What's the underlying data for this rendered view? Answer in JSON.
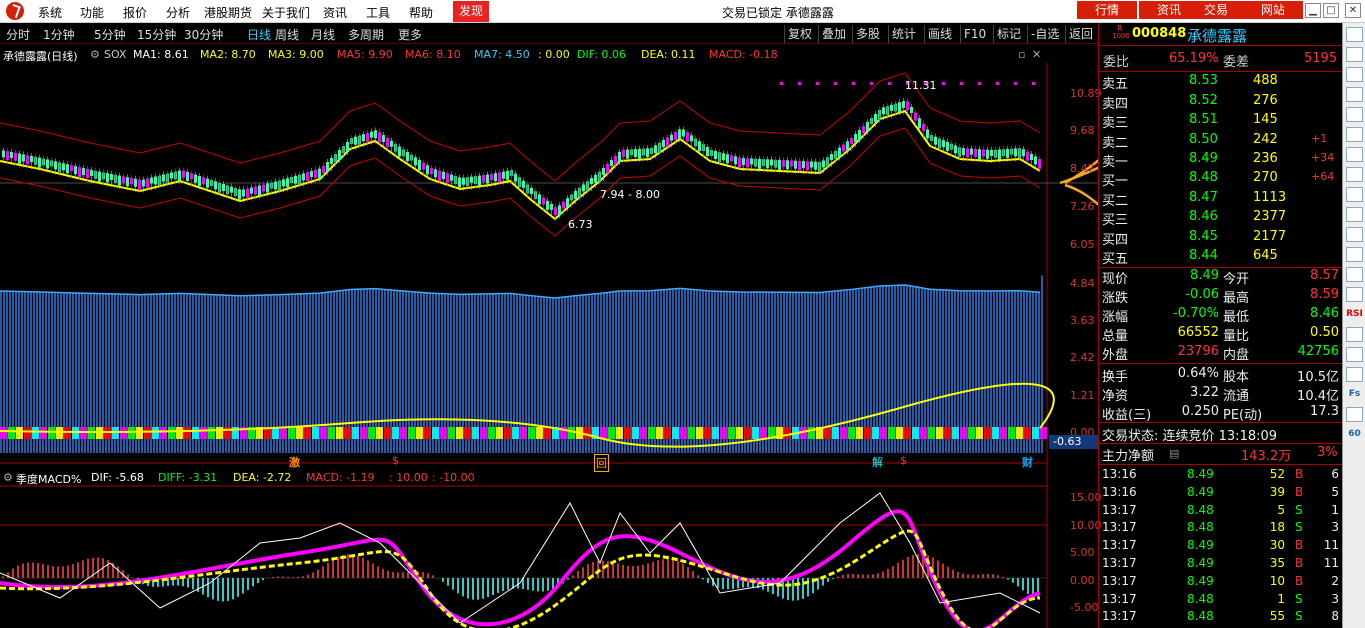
{
  "menu": {
    "items": [
      "系统",
      "功能",
      "报价",
      "分析",
      "港股期货",
      "关于我们",
      "资讯",
      "工具",
      "帮助"
    ],
    "active": "发现",
    "title": "交易已锁定  承德露露",
    "right": [
      "行情",
      "资讯",
      "交易",
      "网站"
    ]
  },
  "period_tabs": {
    "items": [
      "分时",
      "1分钟",
      "5分钟",
      "15分钟",
      "30分钟",
      "日线",
      "周线",
      "月线",
      "多周期",
      "更多"
    ],
    "active": "日线"
  },
  "right_tools": [
    "复权",
    "叠加",
    "多股",
    "统计",
    "画线",
    "F10",
    "标记",
    "-自选",
    "返回"
  ],
  "main_ind": {
    "name": "承德露露(日线)",
    "sox": "SOX",
    "ma1": "MA1: 8.61",
    "ma2": "MA2: 8.70",
    "ma3": "MA3: 9.00",
    "ma5": "MA5: 9.90",
    "ma6": "MA6: 8.10",
    "ma7": "MA7: 4.50",
    "v0": ": 0.00",
    "dif": "DIF: 0.06",
    "dea": "DEA: 0.11",
    "macd": "MACD: -0.18"
  },
  "annotations": {
    "high": "11.31",
    "low": "6.73",
    "range": "7.94 - 8.00",
    "neg": "-0.63"
  },
  "markers": [
    "激",
    "$",
    "回",
    "解",
    "$",
    "财"
  ],
  "axis_main": [
    "10.89",
    "9.68",
    "8.47",
    "7.26",
    "6.05",
    "4.84",
    "3.63",
    "2.42",
    "1.21",
    "0.00"
  ],
  "axis_sub": [
    "15.00",
    "10.00",
    "5.00",
    "0.00",
    "-5.00"
  ],
  "sub_ind": {
    "name": "季度MACD%",
    "dif": "DIF: -5.68",
    "diff": "DIFF: -3.31",
    "dea": "DEA: -2.72",
    "macd": "MACD: -1.19",
    "a": ": 10.00",
    "b": ": -10.00"
  },
  "quote": {
    "code": "000848",
    "name": "承德露露",
    "r_label": "R",
    "r_sub": "1000",
    "wb_label": "委比",
    "wb": "65.19%",
    "wc_label": "委差",
    "wc": "5195",
    "asks": [
      {
        "l": "卖五",
        "p": "8.53",
        "v": "488",
        "d": ""
      },
      {
        "l": "卖四",
        "p": "8.52",
        "v": "276",
        "d": ""
      },
      {
        "l": "卖三",
        "p": "8.51",
        "v": "145",
        "d": ""
      },
      {
        "l": "卖二",
        "p": "8.50",
        "v": "242",
        "d": "+1"
      },
      {
        "l": "卖一",
        "p": "8.49",
        "v": "236",
        "d": "+34"
      }
    ],
    "bids": [
      {
        "l": "买一",
        "p": "8.48",
        "v": "270",
        "d": "+64"
      },
      {
        "l": "买二",
        "p": "8.47",
        "v": "1113",
        "d": ""
      },
      {
        "l": "买三",
        "p": "8.46",
        "v": "2377",
        "d": ""
      },
      {
        "l": "买四",
        "p": "8.45",
        "v": "2177",
        "d": ""
      },
      {
        "l": "买五",
        "p": "8.44",
        "v": "645",
        "d": ""
      }
    ],
    "stats": [
      [
        "现价",
        "8.49",
        "今开",
        "8.57"
      ],
      [
        "涨跌",
        "-0.06",
        "最高",
        "8.59"
      ],
      [
        "涨幅",
        "-0.70%",
        "最低",
        "8.46"
      ],
      [
        "总量",
        "66552",
        "量比",
        "0.50"
      ],
      [
        "外盘",
        "23796",
        "内盘",
        "42756"
      ]
    ],
    "stats2": [
      [
        "换手",
        "0.64%",
        "股本",
        "10.5亿"
      ],
      [
        "净资",
        "3.22",
        "流通",
        "10.4亿"
      ],
      [
        "收益(三)",
        "0.250",
        "PE(动)",
        "17.3"
      ]
    ],
    "status": "交易状态: 连续竞价 13:18:09",
    "zl_label": "主力净额",
    "zl": "143.2万",
    "zl_pct": "3%",
    "ticks": [
      [
        "13:16",
        "8.49",
        "52",
        "B",
        "6"
      ],
      [
        "13:16",
        "8.49",
        "39",
        "B",
        "5"
      ],
      [
        "13:17",
        "8.48",
        "5",
        "S",
        "1"
      ],
      [
        "13:17",
        "8.48",
        "18",
        "S",
        "3"
      ],
      [
        "13:17",
        "8.49",
        "30",
        "B",
        "11"
      ],
      [
        "13:17",
        "8.49",
        "35",
        "B",
        "11"
      ],
      [
        "13:17",
        "8.49",
        "10",
        "B",
        "2"
      ],
      [
        "13:17",
        "8.48",
        "1",
        "S",
        "3"
      ],
      [
        "13:17",
        "8.48",
        "55",
        "S",
        "8"
      ]
    ]
  },
  "sidebar": [
    "s1",
    "s2",
    "s3",
    "s4",
    "s5",
    "s6",
    "s7",
    "s8",
    "s9",
    "s10",
    "s11",
    "s12",
    "s13",
    "s14",
    "RSI",
    "s16",
    "s17",
    "s18",
    "Fs",
    "s20",
    "60"
  ],
  "colors": {
    "up": "#ff3333",
    "down": "#00ff00",
    "accent": "#d81e06"
  }
}
